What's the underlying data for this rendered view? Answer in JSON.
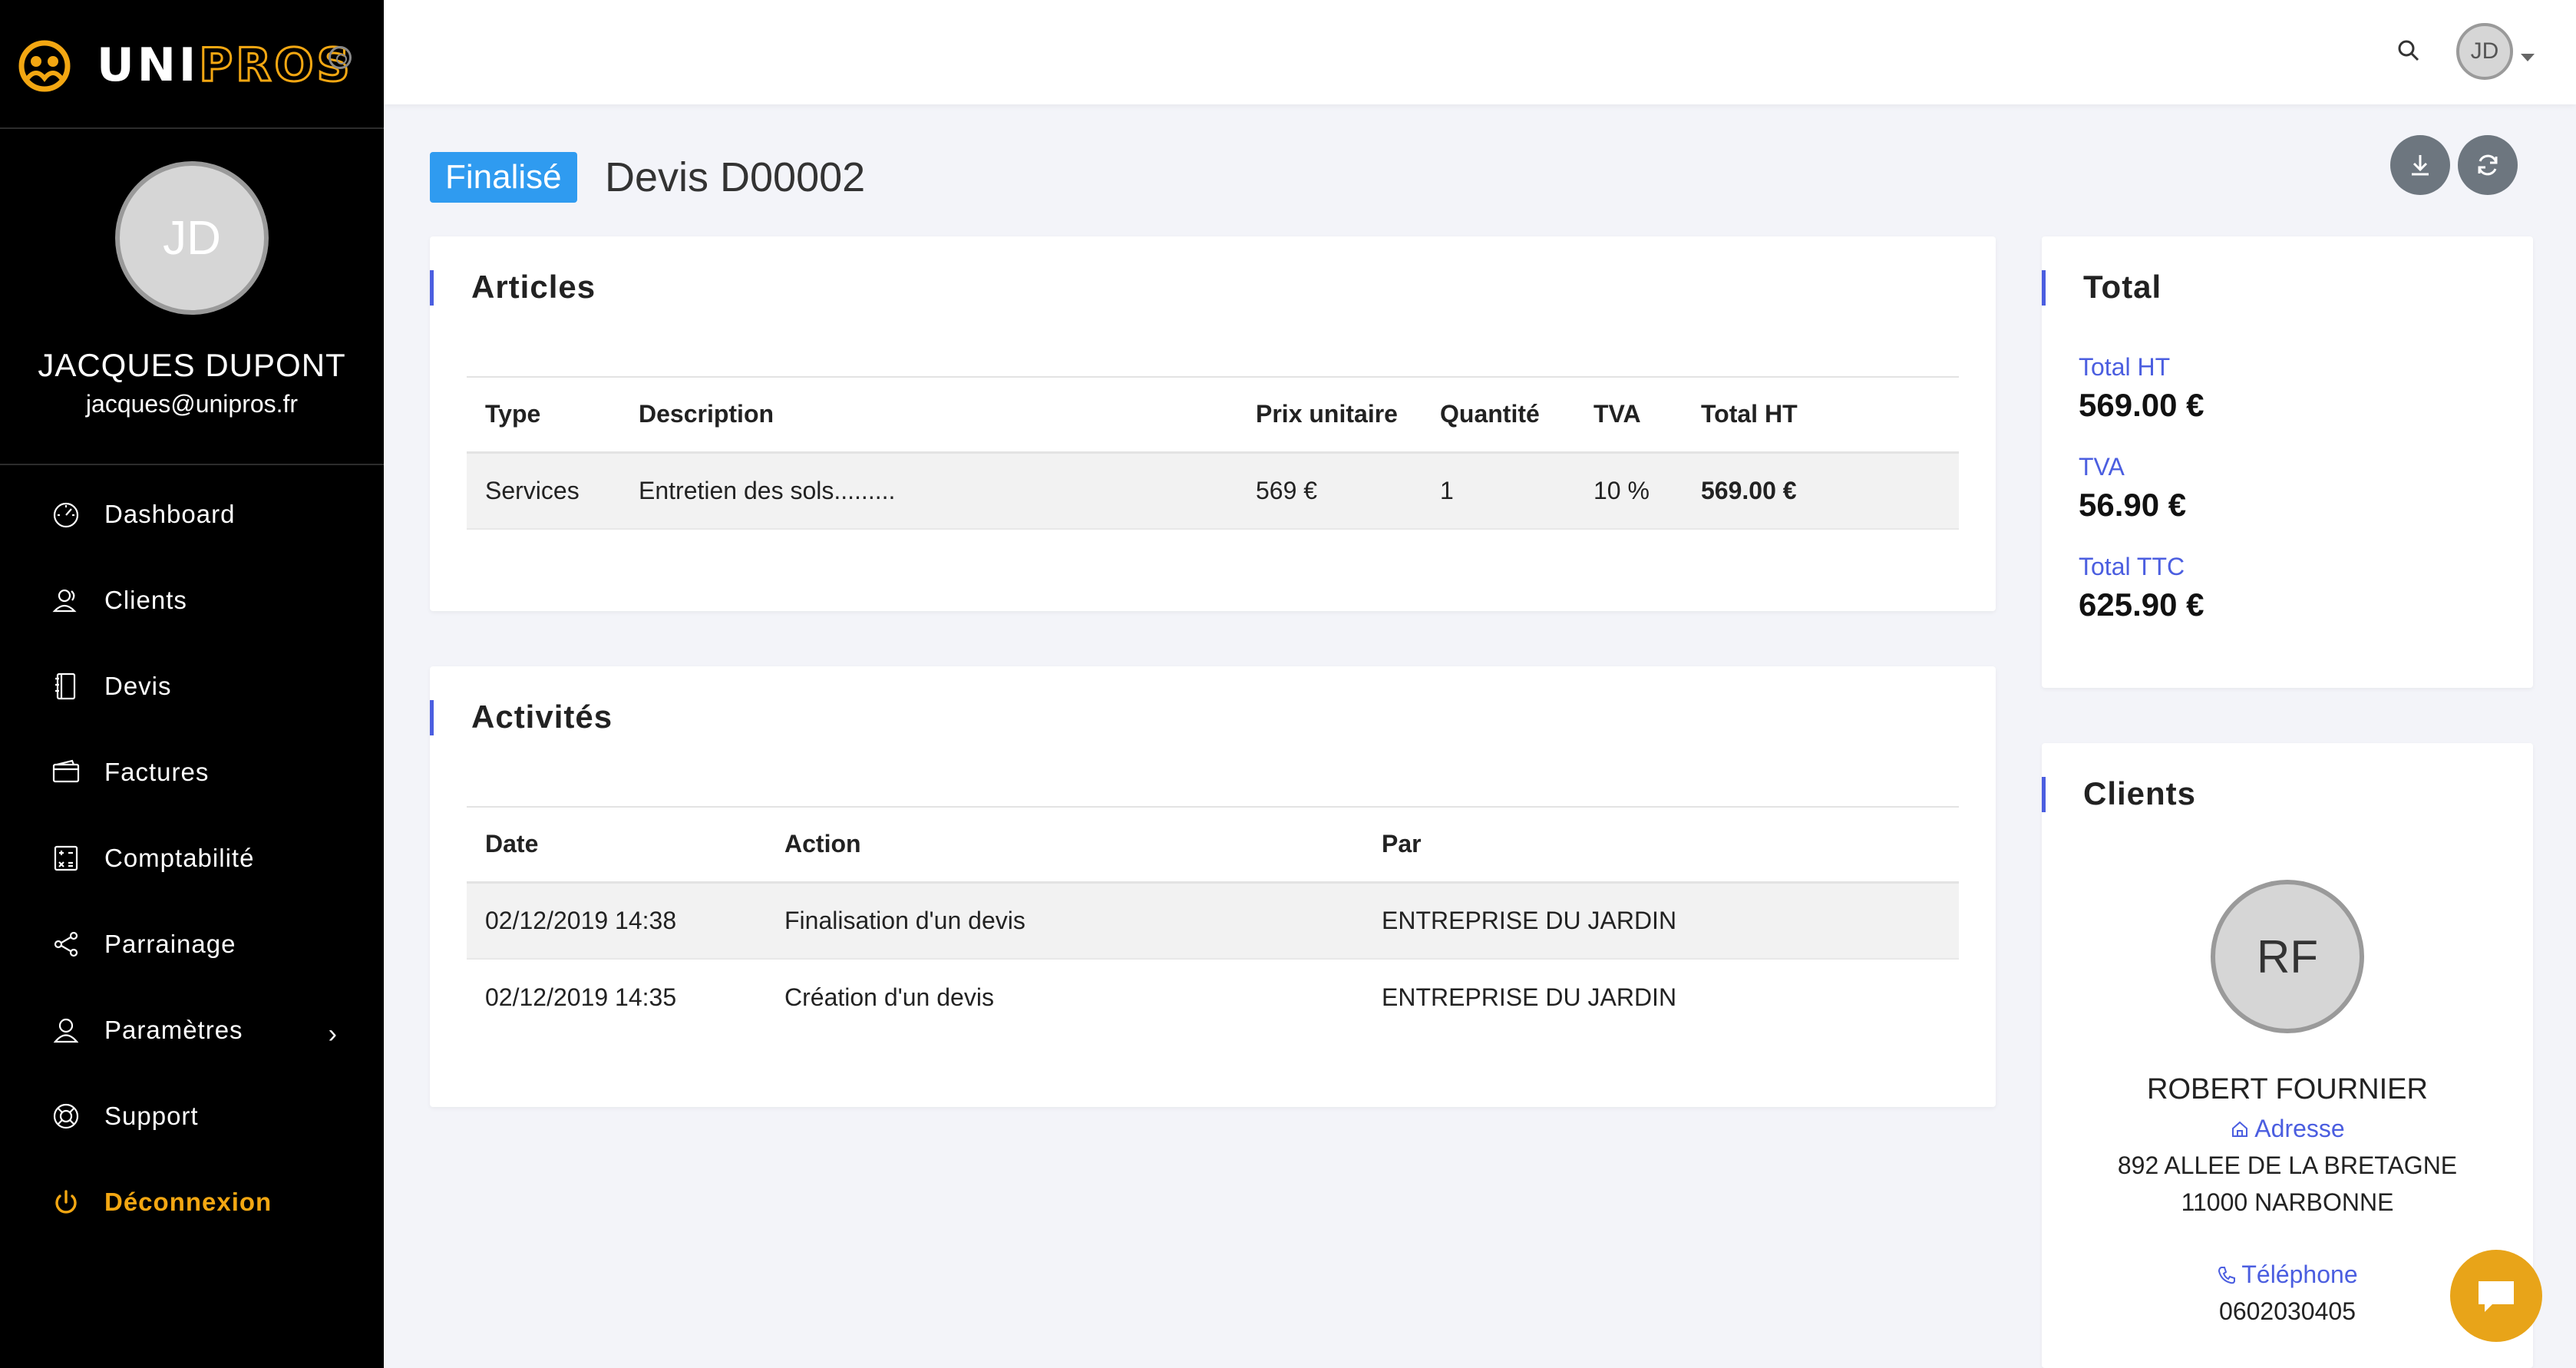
{
  "brand": {
    "name_part1": "UNI",
    "name_part2": "PROS"
  },
  "user": {
    "initials": "JD",
    "name": "JACQUES DUPONT",
    "email": "jacques@unipros.fr"
  },
  "nav": {
    "items": [
      {
        "label": "Dashboard",
        "icon": "gauge-icon"
      },
      {
        "label": "Clients",
        "icon": "users-icon"
      },
      {
        "label": "Devis",
        "icon": "notebook-icon"
      },
      {
        "label": "Factures",
        "icon": "wallet-icon"
      },
      {
        "label": "Comptabilité",
        "icon": "calculator-icon"
      },
      {
        "label": "Parrainage",
        "icon": "share-icon"
      },
      {
        "label": "Paramètres",
        "icon": "user-icon"
      },
      {
        "label": "Support",
        "icon": "lifebuoy-icon"
      }
    ],
    "logout": "Déconnexion"
  },
  "header": {
    "status": "Finalisé",
    "title": "Devis D00002"
  },
  "articles": {
    "title": "Articles",
    "columns": [
      "Type",
      "Description",
      "Prix unitaire",
      "Quantité",
      "TVA",
      "Total HT"
    ],
    "rows": [
      [
        "Services",
        "Entretien des sols.........",
        "569 €",
        "1",
        "10 %",
        "569.00 €"
      ]
    ]
  },
  "activities": {
    "title": "Activités",
    "columns": [
      "Date",
      "Action",
      "Par"
    ],
    "rows": [
      [
        "02/12/2019 14:38",
        "Finalisation d'un devis",
        "ENTREPRISE DU JARDIN"
      ],
      [
        "02/12/2019 14:35",
        "Création d'un devis",
        "ENTREPRISE DU JARDIN"
      ]
    ]
  },
  "totals": {
    "title": "Total",
    "ht_label": "Total HT",
    "ht_value": "569.00 €",
    "tva_label": "TVA",
    "tva_value": "56.90 €",
    "ttc_label": "Total TTC",
    "ttc_value": "625.90 €"
  },
  "client": {
    "title": "Clients",
    "initials": "RF",
    "name": "ROBERT FOURNIER",
    "address_label": "Adresse",
    "address_line1": "892 ALLEE DE LA BRETAGNE",
    "address_line2": "11000 NARBONNE",
    "phone_label": "Téléphone",
    "phone": "0602030405"
  },
  "colors": {
    "accent": "#4b5ee0",
    "brand": "#f3a712",
    "badge": "#2f9bf0",
    "sidebar": "#000000"
  }
}
